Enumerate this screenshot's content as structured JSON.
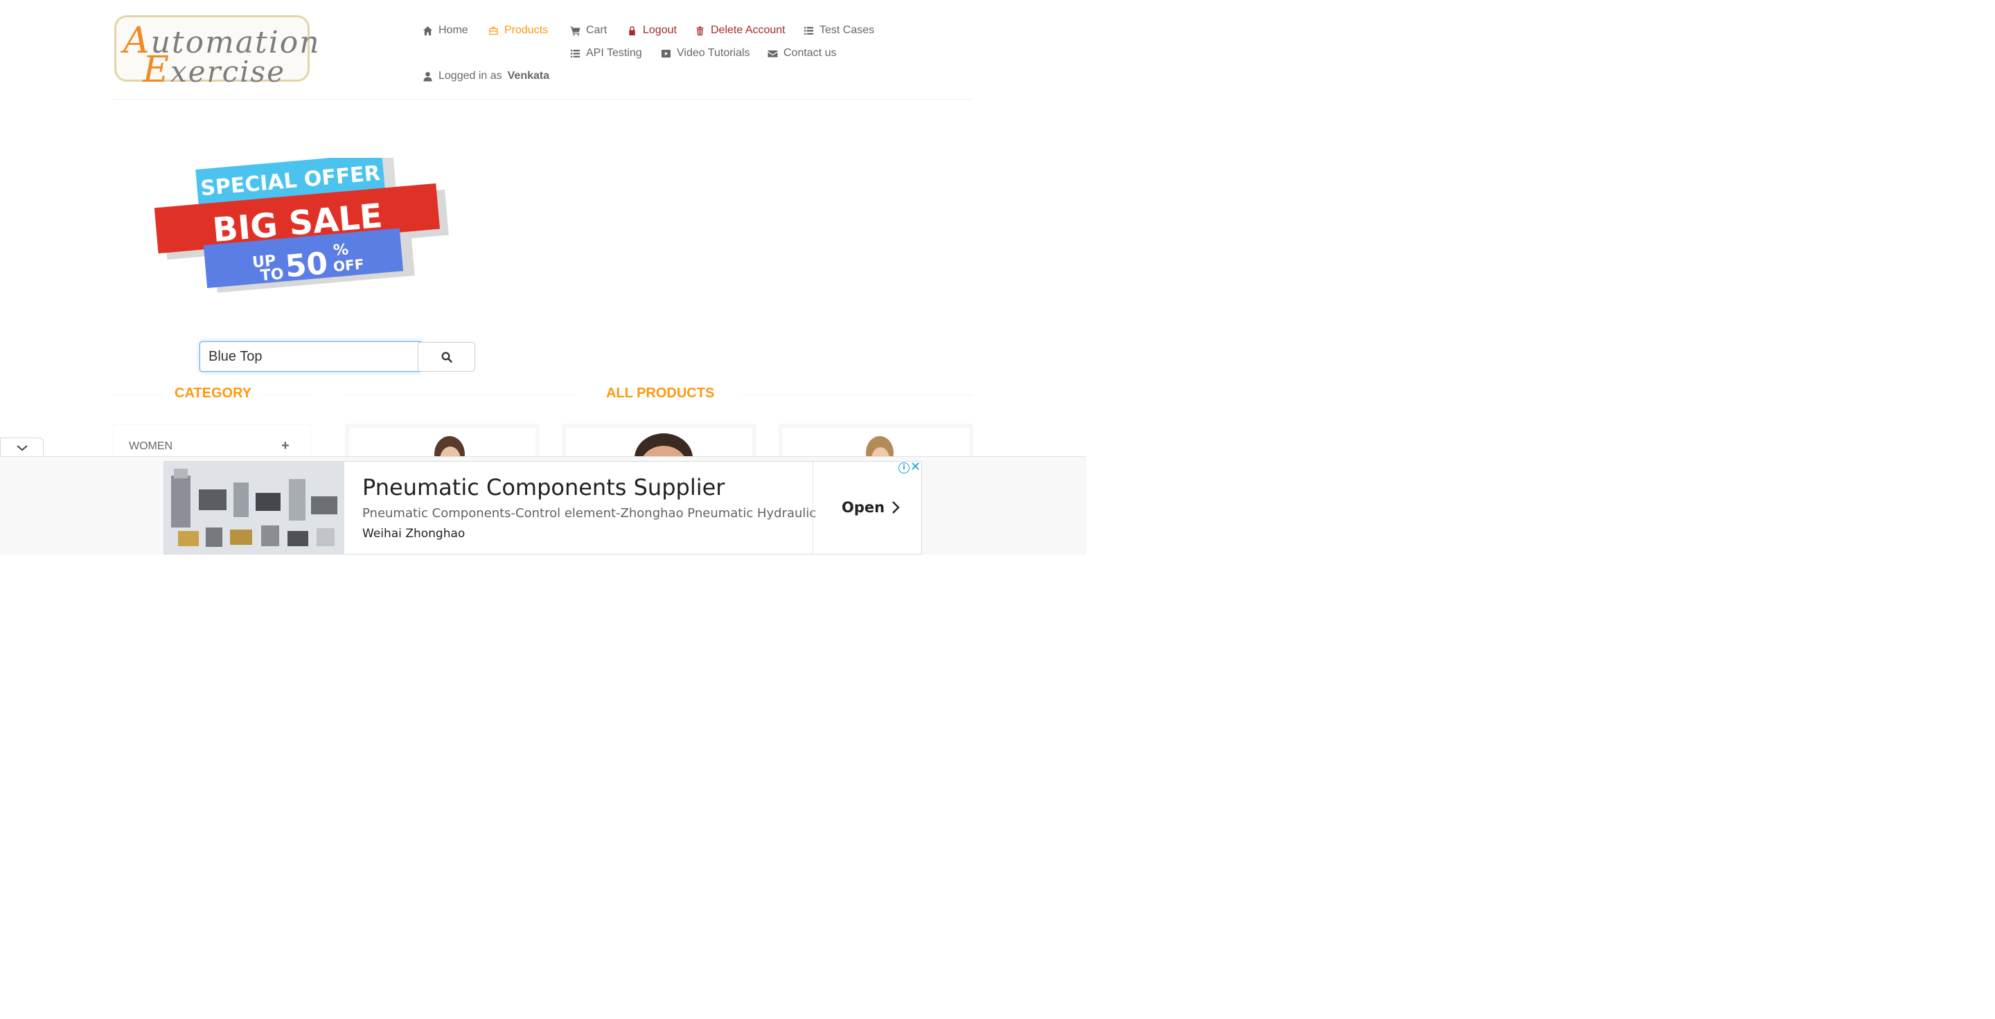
{
  "logo": {
    "line1_cap": "A",
    "line1_rest": "utomation",
    "line2_cap": "E",
    "line2_rest": "xercise"
  },
  "nav": {
    "home": "Home",
    "products": "Products",
    "cart": "Cart",
    "logout": "Logout",
    "delete_account": "Delete Account",
    "test_cases": "Test Cases",
    "api_testing": "API Testing",
    "video_tutorials": "Video Tutorials",
    "contact_us": "Contact us",
    "logged_in_prefix": "Logged in as",
    "logged_in_user": "Venkata"
  },
  "banner": {
    "line1": "SPECIAL OFFER",
    "line2": "BIG SALE",
    "up": "UP",
    "to": "TO",
    "pct": "50",
    "percent_sign": "%",
    "off": "OFF"
  },
  "search": {
    "value": "Blue Top",
    "button_icon": "search-icon"
  },
  "sections": {
    "category_title": "CATEGORY",
    "products_title": "ALL PRODUCTS"
  },
  "category": {
    "items": [
      {
        "label": "WOMEN",
        "expand": "+"
      }
    ]
  },
  "ad": {
    "title": "Pneumatic Components Supplier",
    "description": "Pneumatic Components-Control element-Zhonghao Pneumatic Hydraulic",
    "advertiser": "Weihai Zhonghao",
    "cta": "Open",
    "info": "i",
    "close": "✕"
  },
  "colors": {
    "accent": "#fe980f",
    "danger": "#a52a2a",
    "text": "#696763",
    "focus": "#66afe9"
  }
}
